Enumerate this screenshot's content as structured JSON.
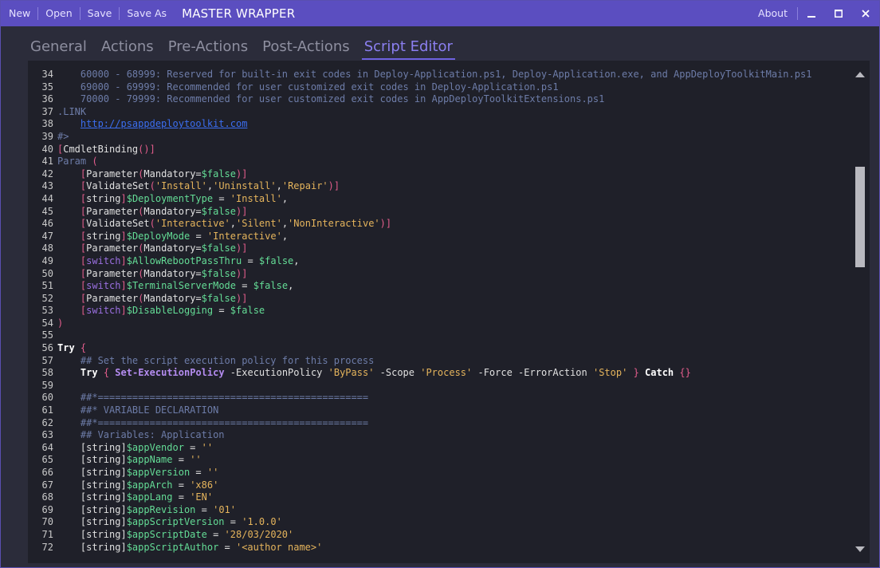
{
  "toolbar": {
    "new": "New",
    "open": "Open",
    "save": "Save",
    "save_as": "Save As",
    "title": "MASTER WRAPPER",
    "about": "About"
  },
  "tabs": [
    {
      "label": "General"
    },
    {
      "label": "Actions"
    },
    {
      "label": "Pre-Actions"
    },
    {
      "label": "Post-Actions"
    },
    {
      "label": "Script Editor",
      "active": true
    }
  ],
  "colors": {
    "titlebar": "#5b4ec0",
    "accent": "#8b7ff0",
    "editor_bg": "#1f2029"
  },
  "icons": {
    "minimize": "minimize-icon",
    "maximize": "maximize-icon",
    "close": "close-icon",
    "scroll_up": "scroll-up-icon",
    "scroll_down": "scroll-down-icon"
  },
  "scroll": {
    "position_fraction": 0.2
  },
  "code_lines": [
    {
      "n": "34",
      "tokens": [
        [
          "c-com",
          "    60000 - 68999: Reserved for built-in exit codes in Deploy-Application.ps1, Deploy-Application.exe, and AppDeployToolkitMain.ps1"
        ]
      ]
    },
    {
      "n": "35",
      "tokens": [
        [
          "c-com",
          "    69000 - 69999: Recommended for user customized exit codes in Deploy-Application.ps1"
        ]
      ]
    },
    {
      "n": "36",
      "tokens": [
        [
          "c-com",
          "    70000 - 79999: Recommended for user customized exit codes in AppDeployToolkitExtensions.ps1"
        ]
      ]
    },
    {
      "n": "37",
      "tokens": [
        [
          "c-com",
          ".LINK"
        ]
      ]
    },
    {
      "n": "38",
      "tokens": [
        [
          "c-com",
          "    "
        ],
        [
          "c-link",
          "http://psappdeploytoolkit.com"
        ]
      ]
    },
    {
      "n": "39",
      "tokens": [
        [
          "c-com",
          "#>"
        ]
      ]
    },
    {
      "n": "40",
      "tokens": [
        [
          "c-brk",
          "["
        ],
        [
          "c-type",
          "CmdletBinding"
        ],
        [
          "c-brk",
          "("
        ],
        [
          "c-brk",
          ")]"
        ]
      ]
    },
    {
      "n": "41",
      "tokens": [
        [
          "c-key",
          "Param"
        ],
        [
          "c-plain",
          " "
        ],
        [
          "c-brk",
          "("
        ]
      ]
    },
    {
      "n": "42",
      "tokens": [
        [
          "c-plain",
          "    "
        ],
        [
          "c-brk",
          "["
        ],
        [
          "c-type",
          "Parameter"
        ],
        [
          "c-brk",
          "("
        ],
        [
          "c-type",
          "Mandatory="
        ],
        [
          "c-var",
          "$false"
        ],
        [
          "c-brk",
          ")]"
        ]
      ]
    },
    {
      "n": "43",
      "tokens": [
        [
          "c-plain",
          "    "
        ],
        [
          "c-brk",
          "["
        ],
        [
          "c-type",
          "ValidateSet"
        ],
        [
          "c-brk",
          "("
        ],
        [
          "c-str",
          "'Install'"
        ],
        [
          "c-plain",
          ","
        ],
        [
          "c-str",
          "'Uninstall'"
        ],
        [
          "c-plain",
          ","
        ],
        [
          "c-str",
          "'Repair'"
        ],
        [
          "c-brk",
          ")]"
        ]
      ]
    },
    {
      "n": "44",
      "tokens": [
        [
          "c-plain",
          "    "
        ],
        [
          "c-brk",
          "["
        ],
        [
          "c-type",
          "string"
        ],
        [
          "c-brk",
          "]"
        ],
        [
          "c-var",
          "$DeploymentType"
        ],
        [
          "c-plain",
          " = "
        ],
        [
          "c-str",
          "'Install'"
        ],
        [
          "c-plain",
          ","
        ]
      ]
    },
    {
      "n": "45",
      "tokens": [
        [
          "c-plain",
          "    "
        ],
        [
          "c-brk",
          "["
        ],
        [
          "c-type",
          "Parameter"
        ],
        [
          "c-brk",
          "("
        ],
        [
          "c-type",
          "Mandatory="
        ],
        [
          "c-var",
          "$false"
        ],
        [
          "c-brk",
          ")]"
        ]
      ]
    },
    {
      "n": "46",
      "tokens": [
        [
          "c-plain",
          "    "
        ],
        [
          "c-brk",
          "["
        ],
        [
          "c-type",
          "ValidateSet"
        ],
        [
          "c-brk",
          "("
        ],
        [
          "c-str",
          "'Interactive'"
        ],
        [
          "c-plain",
          ","
        ],
        [
          "c-str",
          "'Silent'"
        ],
        [
          "c-plain",
          ","
        ],
        [
          "c-str",
          "'NonInteractive'"
        ],
        [
          "c-brk",
          ")]"
        ]
      ]
    },
    {
      "n": "47",
      "tokens": [
        [
          "c-plain",
          "    "
        ],
        [
          "c-brk",
          "["
        ],
        [
          "c-type",
          "string"
        ],
        [
          "c-brk",
          "]"
        ],
        [
          "c-var",
          "$DeployMode"
        ],
        [
          "c-plain",
          " = "
        ],
        [
          "c-str",
          "'Interactive'"
        ],
        [
          "c-plain",
          ","
        ]
      ]
    },
    {
      "n": "48",
      "tokens": [
        [
          "c-plain",
          "    "
        ],
        [
          "c-brk",
          "["
        ],
        [
          "c-type",
          "Parameter"
        ],
        [
          "c-brk",
          "("
        ],
        [
          "c-type",
          "Mandatory="
        ],
        [
          "c-var",
          "$false"
        ],
        [
          "c-brk",
          ")]"
        ]
      ]
    },
    {
      "n": "49",
      "tokens": [
        [
          "c-plain",
          "    "
        ],
        [
          "c-brk",
          "["
        ],
        [
          "c-sw",
          "switch"
        ],
        [
          "c-brk",
          "]"
        ],
        [
          "c-var",
          "$AllowRebootPassThru"
        ],
        [
          "c-plain",
          " = "
        ],
        [
          "c-var",
          "$false"
        ],
        [
          "c-plain",
          ","
        ]
      ]
    },
    {
      "n": "50",
      "tokens": [
        [
          "c-plain",
          "    "
        ],
        [
          "c-brk",
          "["
        ],
        [
          "c-type",
          "Parameter"
        ],
        [
          "c-brk",
          "("
        ],
        [
          "c-type",
          "Mandatory="
        ],
        [
          "c-var",
          "$false"
        ],
        [
          "c-brk",
          ")]"
        ]
      ]
    },
    {
      "n": "51",
      "tokens": [
        [
          "c-plain",
          "    "
        ],
        [
          "c-brk",
          "["
        ],
        [
          "c-sw",
          "switch"
        ],
        [
          "c-brk",
          "]"
        ],
        [
          "c-var",
          "$TerminalServerMode"
        ],
        [
          "c-plain",
          " = "
        ],
        [
          "c-var",
          "$false"
        ],
        [
          "c-plain",
          ","
        ]
      ]
    },
    {
      "n": "52",
      "tokens": [
        [
          "c-plain",
          "    "
        ],
        [
          "c-brk",
          "["
        ],
        [
          "c-type",
          "Parameter"
        ],
        [
          "c-brk",
          "("
        ],
        [
          "c-type",
          "Mandatory="
        ],
        [
          "c-var",
          "$false"
        ],
        [
          "c-brk",
          ")]"
        ]
      ]
    },
    {
      "n": "53",
      "tokens": [
        [
          "c-plain",
          "    "
        ],
        [
          "c-brk",
          "["
        ],
        [
          "c-sw",
          "switch"
        ],
        [
          "c-brk",
          "]"
        ],
        [
          "c-var",
          "$DisableLogging"
        ],
        [
          "c-plain",
          " = "
        ],
        [
          "c-var",
          "$false"
        ]
      ]
    },
    {
      "n": "54",
      "tokens": [
        [
          "c-brk",
          ")"
        ]
      ]
    },
    {
      "n": "55",
      "tokens": []
    },
    {
      "n": "56",
      "tokens": [
        [
          "c-kw",
          "Try"
        ],
        [
          "c-plain",
          " "
        ],
        [
          "c-brk",
          "{"
        ]
      ]
    },
    {
      "n": "57",
      "tokens": [
        [
          "c-com",
          "    ## Set the script execution policy for this process"
        ]
      ]
    },
    {
      "n": "58",
      "tokens": [
        [
          "c-plain",
          "    "
        ],
        [
          "c-kw",
          "Try"
        ],
        [
          "c-plain",
          " "
        ],
        [
          "c-brk",
          "{"
        ],
        [
          "c-plain",
          " "
        ],
        [
          "c-cmd",
          "Set-ExecutionPolicy"
        ],
        [
          "c-plain",
          " -ExecutionPolicy "
        ],
        [
          "c-str",
          "'ByPass'"
        ],
        [
          "c-plain",
          " -Scope "
        ],
        [
          "c-str",
          "'Process'"
        ],
        [
          "c-plain",
          " -Force -ErrorAction "
        ],
        [
          "c-str",
          "'Stop'"
        ],
        [
          "c-plain",
          " "
        ],
        [
          "c-brk",
          "}"
        ],
        [
          "c-plain",
          " "
        ],
        [
          "c-kw",
          "Catch"
        ],
        [
          "c-plain",
          " "
        ],
        [
          "c-brk",
          "{}"
        ]
      ]
    },
    {
      "n": "59",
      "tokens": []
    },
    {
      "n": "60",
      "tokens": [
        [
          "c-com",
          "    ##*==============================================="
        ]
      ]
    },
    {
      "n": "61",
      "tokens": [
        [
          "c-com",
          "    ##* VARIABLE DECLARATION"
        ]
      ]
    },
    {
      "n": "62",
      "tokens": [
        [
          "c-com",
          "    ##*==============================================="
        ]
      ]
    },
    {
      "n": "63",
      "tokens": [
        [
          "c-com",
          "    ## Variables: Application"
        ]
      ]
    },
    {
      "n": "64",
      "tokens": [
        [
          "c-plain",
          "    "
        ],
        [
          "c-type",
          "[string]"
        ],
        [
          "c-var",
          "$appVendor"
        ],
        [
          "c-plain",
          " = "
        ],
        [
          "c-str",
          "''"
        ]
      ]
    },
    {
      "n": "65",
      "tokens": [
        [
          "c-plain",
          "    "
        ],
        [
          "c-type",
          "[string]"
        ],
        [
          "c-var",
          "$appName"
        ],
        [
          "c-plain",
          " = "
        ],
        [
          "c-str",
          "''"
        ]
      ]
    },
    {
      "n": "66",
      "tokens": [
        [
          "c-plain",
          "    "
        ],
        [
          "c-type",
          "[string]"
        ],
        [
          "c-var",
          "$appVersion"
        ],
        [
          "c-plain",
          " = "
        ],
        [
          "c-str",
          "''"
        ]
      ]
    },
    {
      "n": "67",
      "tokens": [
        [
          "c-plain",
          "    "
        ],
        [
          "c-type",
          "[string]"
        ],
        [
          "c-var",
          "$appArch"
        ],
        [
          "c-plain",
          " = "
        ],
        [
          "c-str",
          "'x86'"
        ]
      ]
    },
    {
      "n": "68",
      "tokens": [
        [
          "c-plain",
          "    "
        ],
        [
          "c-type",
          "[string]"
        ],
        [
          "c-var",
          "$appLang"
        ],
        [
          "c-plain",
          " = "
        ],
        [
          "c-str",
          "'EN'"
        ]
      ]
    },
    {
      "n": "69",
      "tokens": [
        [
          "c-plain",
          "    "
        ],
        [
          "c-type",
          "[string]"
        ],
        [
          "c-var",
          "$appRevision"
        ],
        [
          "c-plain",
          " = "
        ],
        [
          "c-str",
          "'01'"
        ]
      ]
    },
    {
      "n": "70",
      "tokens": [
        [
          "c-plain",
          "    "
        ],
        [
          "c-type",
          "[string]"
        ],
        [
          "c-var",
          "$appScriptVersion"
        ],
        [
          "c-plain",
          " = "
        ],
        [
          "c-str",
          "'1.0.0'"
        ]
      ]
    },
    {
      "n": "71",
      "tokens": [
        [
          "c-plain",
          "    "
        ],
        [
          "c-type",
          "[string]"
        ],
        [
          "c-var",
          "$appScriptDate"
        ],
        [
          "c-plain",
          " = "
        ],
        [
          "c-str",
          "'28/03/2020'"
        ]
      ]
    },
    {
      "n": "72",
      "tokens": [
        [
          "c-plain",
          "    "
        ],
        [
          "c-type",
          "[string]"
        ],
        [
          "c-var",
          "$appScriptAuthor"
        ],
        [
          "c-plain",
          " = "
        ],
        [
          "c-str",
          "'<author name>'"
        ]
      ]
    }
  ]
}
